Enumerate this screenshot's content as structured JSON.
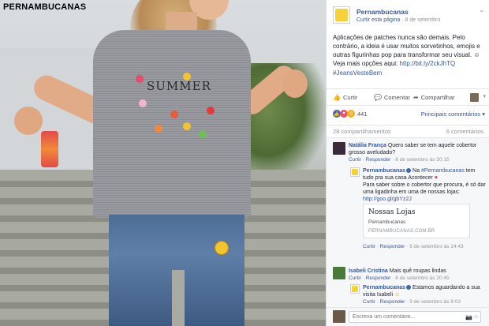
{
  "photo": {
    "brand_logo": "PERNAMBUCANAS",
    "shirt_print": "SUMMER"
  },
  "post": {
    "page_name": "Pernambucanas",
    "meta_prefix": "Curtir esta página",
    "date": "8 de setembro",
    "text": "Aplicações de patches nunca são demais. Pelo contrário, a ideia é usar muitos sorvetinhos, emojis e outras figurinhas pop para transformar seu visual. ",
    "text_after_emoji": " Veja mais opções aqui: ",
    "link": "http://bit.ly/2ckJhTQ",
    "hashtag": "#JeansVesteBem",
    "emoji_icon": "smiley-emoji"
  },
  "actions": {
    "like": "Curtir",
    "comment": "Comentar",
    "share": "Compartilhar"
  },
  "reactions": {
    "count": "441",
    "sort_label": "Principais comentários",
    "icons": [
      "like-reaction-icon",
      "love-reaction-icon",
      "wow-reaction-icon"
    ]
  },
  "counts": {
    "shares": "28 compartilhamentos",
    "comments": "6 comentários"
  },
  "comments": [
    {
      "author": "Natália França",
      "text": "Quero saber se tem aquele cobertor grosso aveludado?",
      "like": "Curtir",
      "reply": "Responder",
      "time": "8 de setembro às 20:15"
    },
    {
      "author": "Pernambucanas",
      "mention_prefix": "Na ",
      "mention": "#Pernambucanas",
      "text": " tem tudo pra sua casa Acontecer",
      "text2": "Para saber sobre o cobertor que procura, é só dar uma ligadinha em uma de nossas lojas: ",
      "link": "http://goo.gl/gbYz2J",
      "like": "Curtir",
      "reply": "Responder",
      "time": "9 de setembro às 14:43"
    },
    {
      "author": "Isabeli Cristina",
      "text": "Mais quê roupas lindas",
      "like": "Curtir",
      "reply": "Responder",
      "time": "8 de setembro às 20:45"
    },
    {
      "author": "Pernambucanas",
      "text": "Estamos aguardando a sua visita Isabeli",
      "like": "Curtir",
      "reply": "Responder",
      "time": "9 de setembro às 9:03"
    }
  ],
  "link_preview": {
    "title": "Nossas Lojas",
    "subtitle": "Pernambucanas",
    "url": "PERNAMBUCANAS.COM.BR"
  },
  "composer": {
    "placeholder": "Escreva um comentário..."
  },
  "colors": {
    "link": "#365899",
    "muted": "#90949c",
    "panel_bg": "#f6f7f9"
  }
}
